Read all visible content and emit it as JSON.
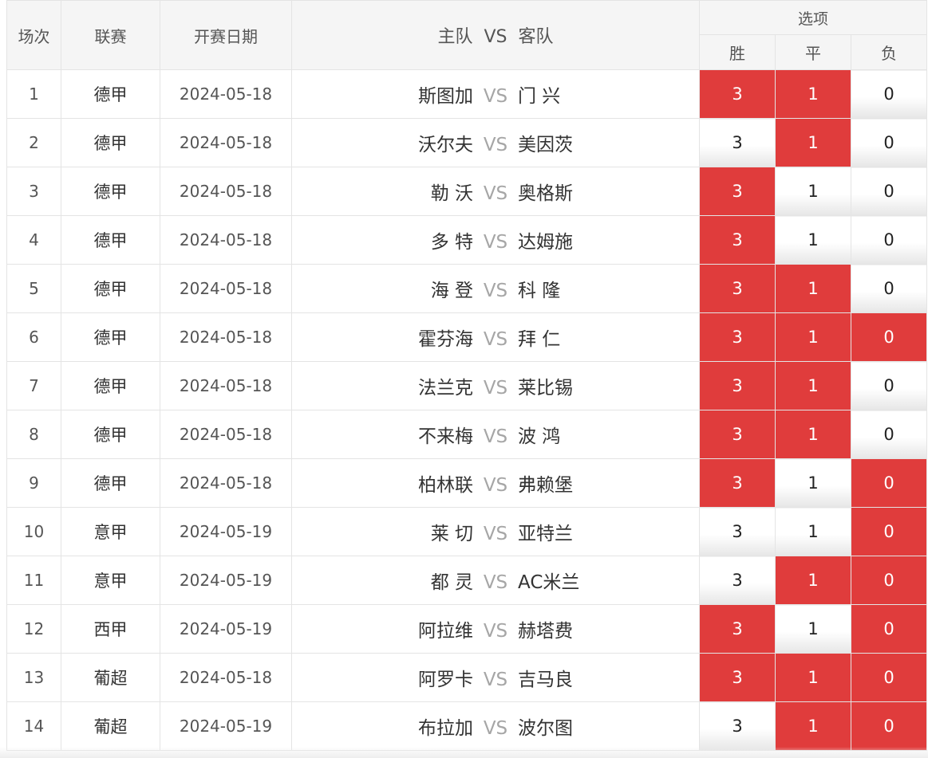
{
  "header": {
    "no": "场次",
    "league": "联赛",
    "date": "开赛日期",
    "home": "主队",
    "vs": "VS",
    "away": "客队",
    "options": "选项",
    "win": "胜",
    "draw": "平",
    "loss": "负"
  },
  "colors": {
    "selected": "#e03c3c",
    "header_bg": "#f5f5f5",
    "vs_text": "#a6a6a6"
  },
  "matches": [
    {
      "no": "1",
      "league": "德甲",
      "date": "2024-05-18",
      "home": "斯图加",
      "vs": "VS",
      "away": "门 兴",
      "win": "3",
      "draw": "1",
      "loss": "0",
      "sel": [
        true,
        true,
        false
      ]
    },
    {
      "no": "2",
      "league": "德甲",
      "date": "2024-05-18",
      "home": "沃尔夫",
      "vs": "VS",
      "away": "美因茨",
      "win": "3",
      "draw": "1",
      "loss": "0",
      "sel": [
        false,
        true,
        false
      ]
    },
    {
      "no": "3",
      "league": "德甲",
      "date": "2024-05-18",
      "home": "勒 沃",
      "vs": "VS",
      "away": "奥格斯",
      "win": "3",
      "draw": "1",
      "loss": "0",
      "sel": [
        true,
        false,
        false
      ]
    },
    {
      "no": "4",
      "league": "德甲",
      "date": "2024-05-18",
      "home": "多 特",
      "vs": "VS",
      "away": "达姆施",
      "win": "3",
      "draw": "1",
      "loss": "0",
      "sel": [
        true,
        false,
        false
      ]
    },
    {
      "no": "5",
      "league": "德甲",
      "date": "2024-05-18",
      "home": "海 登",
      "vs": "VS",
      "away": "科 隆",
      "win": "3",
      "draw": "1",
      "loss": "0",
      "sel": [
        true,
        true,
        false
      ]
    },
    {
      "no": "6",
      "league": "德甲",
      "date": "2024-05-18",
      "home": "霍芬海",
      "vs": "VS",
      "away": "拜 仁",
      "win": "3",
      "draw": "1",
      "loss": "0",
      "sel": [
        true,
        true,
        true
      ]
    },
    {
      "no": "7",
      "league": "德甲",
      "date": "2024-05-18",
      "home": "法兰克",
      "vs": "VS",
      "away": "莱比锡",
      "win": "3",
      "draw": "1",
      "loss": "0",
      "sel": [
        true,
        true,
        false
      ]
    },
    {
      "no": "8",
      "league": "德甲",
      "date": "2024-05-18",
      "home": "不来梅",
      "vs": "VS",
      "away": "波 鸿",
      "win": "3",
      "draw": "1",
      "loss": "0",
      "sel": [
        true,
        true,
        false
      ]
    },
    {
      "no": "9",
      "league": "德甲",
      "date": "2024-05-18",
      "home": "柏林联",
      "vs": "VS",
      "away": "弗赖堡",
      "win": "3",
      "draw": "1",
      "loss": "0",
      "sel": [
        true,
        false,
        true
      ]
    },
    {
      "no": "10",
      "league": "意甲",
      "date": "2024-05-19",
      "home": "莱 切",
      "vs": "VS",
      "away": "亚特兰",
      "win": "3",
      "draw": "1",
      "loss": "0",
      "sel": [
        false,
        false,
        true
      ]
    },
    {
      "no": "11",
      "league": "意甲",
      "date": "2024-05-19",
      "home": "都 灵",
      "vs": "VS",
      "away": "AC米兰",
      "win": "3",
      "draw": "1",
      "loss": "0",
      "sel": [
        false,
        true,
        true
      ]
    },
    {
      "no": "12",
      "league": "西甲",
      "date": "2024-05-19",
      "home": "阿拉维",
      "vs": "VS",
      "away": "赫塔费",
      "win": "3",
      "draw": "1",
      "loss": "0",
      "sel": [
        true,
        false,
        true
      ]
    },
    {
      "no": "13",
      "league": "葡超",
      "date": "2024-05-18",
      "home": "阿罗卡",
      "vs": "VS",
      "away": "吉马良",
      "win": "3",
      "draw": "1",
      "loss": "0",
      "sel": [
        true,
        true,
        true
      ]
    },
    {
      "no": "14",
      "league": "葡超",
      "date": "2024-05-19",
      "home": "布拉加",
      "vs": "VS",
      "away": "波尔图",
      "win": "3",
      "draw": "1",
      "loss": "0",
      "sel": [
        false,
        true,
        true
      ]
    }
  ]
}
